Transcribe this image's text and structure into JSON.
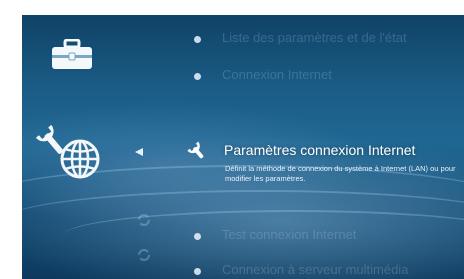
{
  "categories": [
    {
      "name": "toolbox-icon"
    },
    {
      "name": "network-settings-icon"
    }
  ],
  "menu": {
    "items": [
      {
        "label": "Liste des paramètres et de l'état"
      },
      {
        "label": "Connexion Internet"
      },
      {
        "label": "Test connexion Internet"
      },
      {
        "label": "Connexion à serveur multimédia"
      }
    ],
    "selected": {
      "title": "Paramètres connexion Internet",
      "description": "Définit la méthode de connexion du système à Internet (LAN) ou pour modifier les paramètres."
    }
  },
  "colors": {
    "background": "#1b5c86",
    "selected_text": "#ffffff",
    "dim_text": "#bedcf0"
  }
}
